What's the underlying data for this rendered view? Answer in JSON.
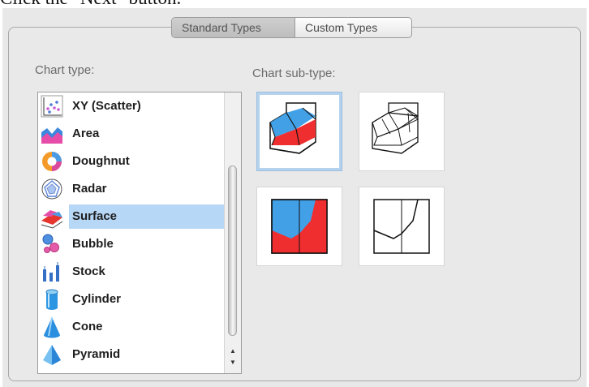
{
  "header": {
    "caption": "Click the \"Next\" button."
  },
  "tabs": [
    {
      "label": "Standard Types",
      "selected": true
    },
    {
      "label": "Custom Types",
      "selected": false
    }
  ],
  "chart_type": {
    "label": "Chart type:",
    "items": [
      {
        "label": "XY (Scatter)",
        "icon": "scatter-chart-icon"
      },
      {
        "label": "Area",
        "icon": "area-chart-icon"
      },
      {
        "label": "Doughnut",
        "icon": "doughnut-chart-icon"
      },
      {
        "label": "Radar",
        "icon": "radar-chart-icon"
      },
      {
        "label": "Surface",
        "icon": "surface-chart-icon",
        "selected": true
      },
      {
        "label": "Bubble",
        "icon": "bubble-chart-icon"
      },
      {
        "label": "Stock",
        "icon": "stock-chart-icon"
      },
      {
        "label": "Cylinder",
        "icon": "cylinder-chart-icon"
      },
      {
        "label": "Cone",
        "icon": "cone-chart-icon"
      },
      {
        "label": "Pyramid",
        "icon": "pyramid-chart-icon"
      }
    ]
  },
  "chart_subtype": {
    "label": "Chart sub-type:",
    "items": [
      {
        "icon": "3d-surface-icon",
        "selected": true
      },
      {
        "icon": "3d-surface-wireframe-icon",
        "selected": false
      },
      {
        "icon": "contour-icon",
        "selected": false
      },
      {
        "icon": "contour-wireframe-icon",
        "selected": false
      }
    ]
  },
  "colors": {
    "selection": "#b7d7f7",
    "surface_blue": "#3ea2e6",
    "surface_red": "#ee2f2f"
  }
}
